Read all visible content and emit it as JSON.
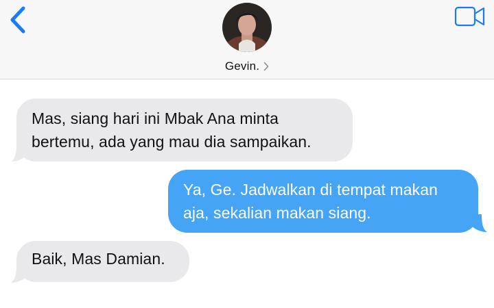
{
  "header": {
    "contact_name": "Gevin.",
    "back_icon": "chevron-left-icon",
    "video_icon": "video-camera-icon",
    "details_icon": "chevron-right-icon",
    "accent_color": "#1a7cf5"
  },
  "messages": [
    {
      "direction": "incoming",
      "lines": [
        "Mas, siang hari ini Mbak Ana minta",
        "bertemu, ada yang mau dia sampaikan."
      ]
    },
    {
      "direction": "outgoing",
      "lines": [
        "Ya, Ge. Jadwalkan di tempat makan",
        "aja, sekalian makan siang."
      ]
    },
    {
      "direction": "incoming",
      "lines": [
        "Baik, Mas Damian."
      ]
    }
  ],
  "colors": {
    "incoming_bubble": "#e9e9eb",
    "outgoing_bubble": "#45a4f5",
    "header_bg": "#f7f7f7"
  }
}
